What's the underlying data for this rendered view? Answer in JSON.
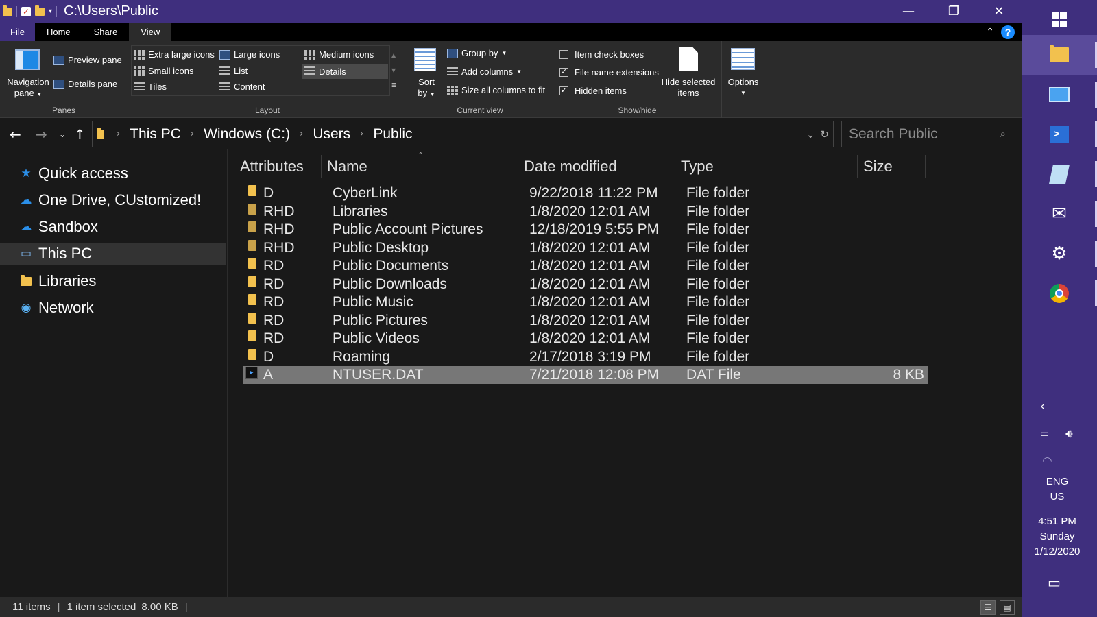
{
  "window": {
    "title": "C:\\Users\\Public",
    "controls": {
      "minimize": "—",
      "maximize": "❐",
      "close": "✕"
    }
  },
  "ribbon_tabs": [
    "File",
    "Home",
    "Share",
    "View"
  ],
  "ribbon": {
    "panes": {
      "navigation_pane": "Navigation",
      "navigation_pane_2": "pane",
      "preview_pane": "Preview pane",
      "details_pane": "Details pane",
      "label": "Panes"
    },
    "layout": {
      "extra_large_icons": "Extra large icons",
      "large_icons": "Large icons",
      "medium_icons": "Medium icons",
      "small_icons": "Small icons",
      "list": "List",
      "details": "Details",
      "tiles": "Tiles",
      "content": "Content",
      "label": "Layout"
    },
    "current_view": {
      "sort": "Sort",
      "sort_2": "by",
      "group_by": "Group by",
      "add_columns": "Add columns",
      "size_all_columns": "Size all columns to fit",
      "label": "Current view"
    },
    "show_hide": {
      "item_check_boxes": "Item check boxes",
      "file_name_extensions": "File name extensions",
      "hidden_items": "Hidden items",
      "hide_selected": "Hide selected",
      "hide_selected_2": "items",
      "label": "Show/hide"
    },
    "options": "Options",
    "checks": {
      "item_check_boxes": false,
      "file_name_extensions": true,
      "hidden_items": true
    }
  },
  "address": {
    "crumbs": [
      "This PC",
      "Windows (C:)",
      "Users",
      "Public"
    ],
    "search_placeholder": "Search Public"
  },
  "nav_pane": [
    {
      "label": "Quick access",
      "icon": "star-icon"
    },
    {
      "label": "One Drive, CUstomized!",
      "icon": "cloud-icon"
    },
    {
      "label": "Sandbox",
      "icon": "cloud-icon"
    },
    {
      "label": "This PC",
      "icon": "computer-icon",
      "selected": true
    },
    {
      "label": "Libraries",
      "icon": "libraries-icon"
    },
    {
      "label": "Network",
      "icon": "network-icon"
    }
  ],
  "columns": [
    "Attributes",
    "Name",
    "Date modified",
    "Type",
    "Size"
  ],
  "files": [
    {
      "attr": "D",
      "name": "CyberLink",
      "date": "9/22/2018 11:22 PM",
      "type": "File folder",
      "size": ""
    },
    {
      "attr": "RHD",
      "name": "Libraries",
      "date": "1/8/2020 12:01 AM",
      "type": "File folder",
      "size": ""
    },
    {
      "attr": "RHD",
      "name": "Public Account Pictures",
      "date": "12/18/2019 5:55 PM",
      "type": "File folder",
      "size": ""
    },
    {
      "attr": "RHD",
      "name": "Public Desktop",
      "date": "1/8/2020 12:01 AM",
      "type": "File folder",
      "size": ""
    },
    {
      "attr": "RD",
      "name": "Public Documents",
      "date": "1/8/2020 12:01 AM",
      "type": "File folder",
      "size": ""
    },
    {
      "attr": "RD",
      "name": "Public Downloads",
      "date": "1/8/2020 12:01 AM",
      "type": "File folder",
      "size": ""
    },
    {
      "attr": "RD",
      "name": "Public Music",
      "date": "1/8/2020 12:01 AM",
      "type": "File folder",
      "size": ""
    },
    {
      "attr": "RD",
      "name": "Public Pictures",
      "date": "1/8/2020 12:01 AM",
      "type": "File folder",
      "size": ""
    },
    {
      "attr": "RD",
      "name": "Public Videos",
      "date": "1/8/2020 12:01 AM",
      "type": "File folder",
      "size": ""
    },
    {
      "attr": "D",
      "name": "Roaming",
      "date": "2/17/2018 3:19 PM",
      "type": "File folder",
      "size": ""
    },
    {
      "attr": "A",
      "name": "NTUSER.DAT",
      "date": "7/21/2018 12:08 PM",
      "type": "DAT File",
      "size": "8 KB",
      "selected": true
    }
  ],
  "status": {
    "items": "11 items",
    "selected": "1 item selected",
    "size": "8.00 KB"
  },
  "tray": {
    "lang": "ENG",
    "region": "US",
    "time": "4:51 PM",
    "day": "Sunday",
    "date": "1/12/2020"
  },
  "colors": {
    "accent": "#3f2f7e",
    "background": "#191919",
    "ribbon": "#2b2b2b",
    "selection": "#777777",
    "folder": "#f2c14e",
    "help": "#1a8cff"
  }
}
